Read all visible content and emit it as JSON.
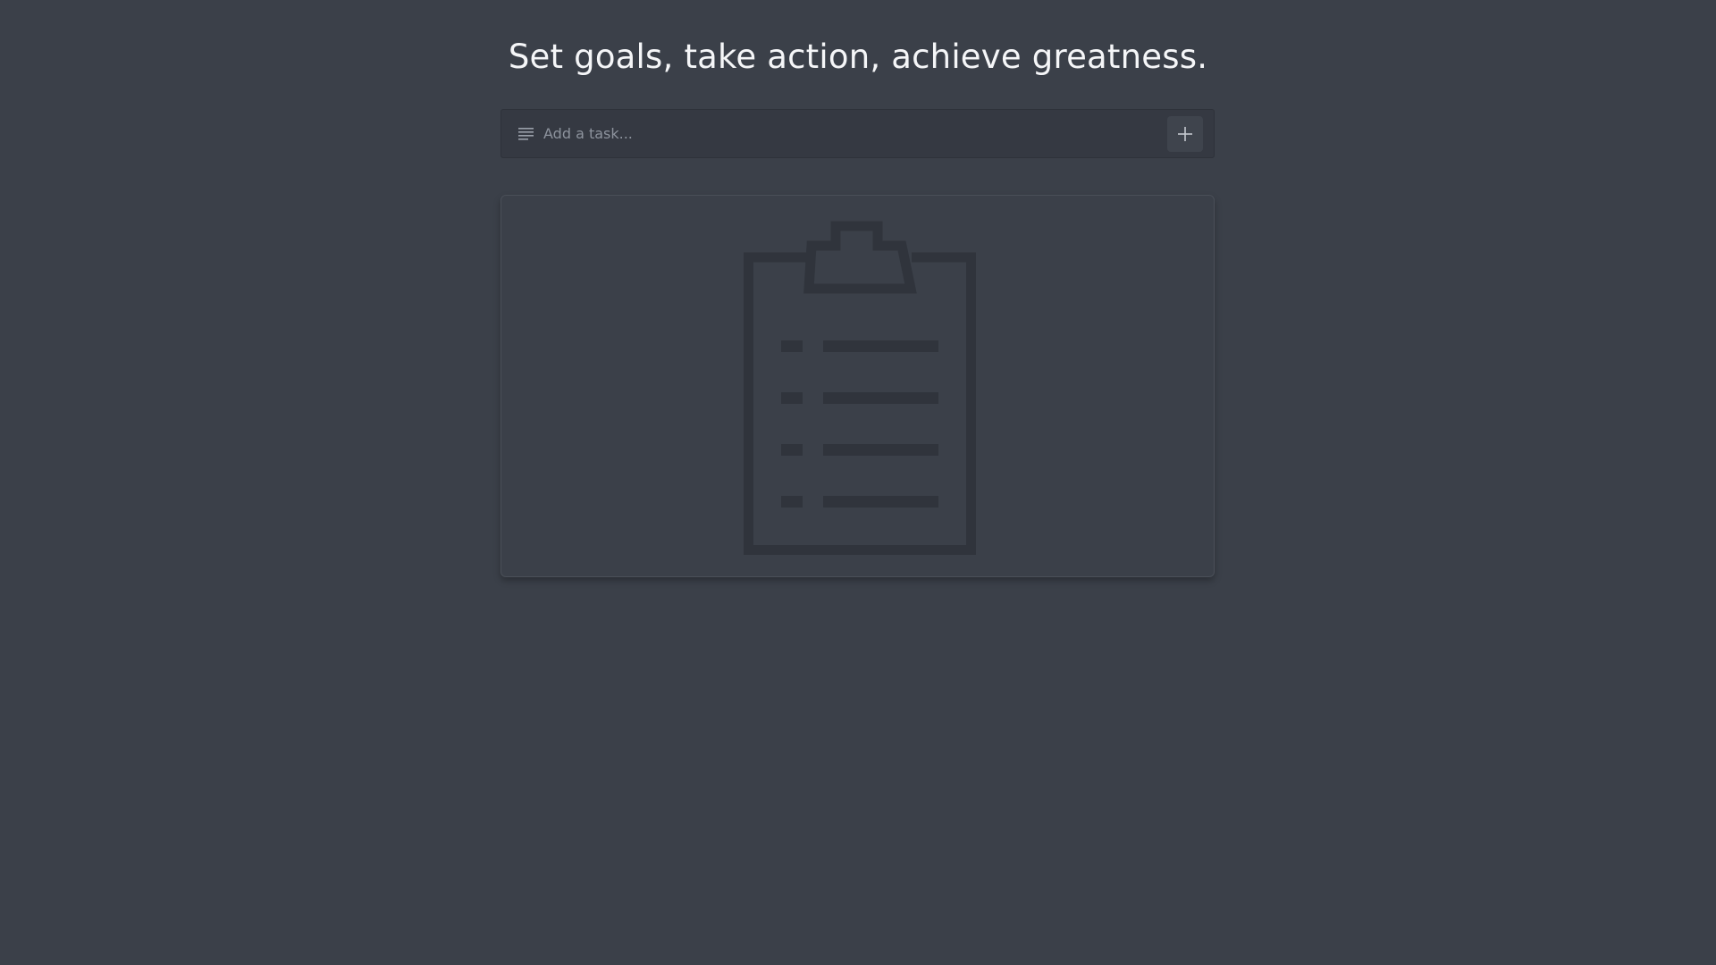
{
  "header": {
    "title": "Set goals, take action, achieve greatness."
  },
  "task_input": {
    "placeholder": "Add a task...",
    "value": "",
    "leading_icon": "list-lines-icon",
    "add_button_icon": "plus-icon"
  },
  "empty_state": {
    "illustration_icon": "clipboard-checklist-icon"
  },
  "colors": {
    "background": "#3b4049",
    "input_background": "#353942",
    "title_text": "#f5f6f8",
    "illustration": "#30343c"
  }
}
